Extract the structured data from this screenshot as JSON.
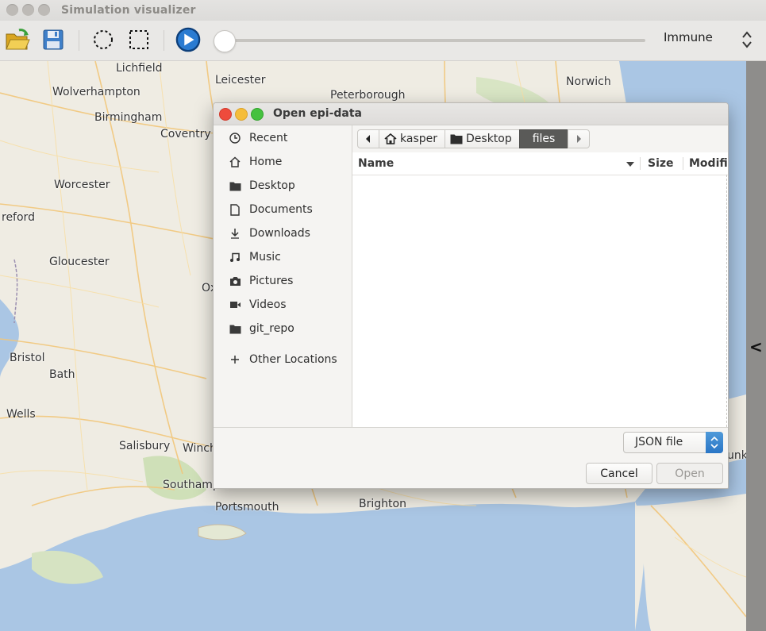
{
  "window": {
    "title": "Simulation visualizer"
  },
  "toolbar": {
    "open_icon": "folder-open-icon",
    "save_icon": "save-icon",
    "circle_select_icon": "circle-select-icon",
    "rect_select_icon": "rect-select-icon",
    "play_icon": "play-icon",
    "timeline_position": 0,
    "mode_select": {
      "value": "Immune"
    }
  },
  "map": {
    "cities": [
      "Lichfield",
      "Leicester",
      "Peterborough",
      "Norwich",
      "Wolverhampton",
      "Birmingham",
      "Coventry",
      "Worcester",
      "reford",
      "Gloucester",
      "Ox",
      "Bristol",
      "Bath",
      "Wells",
      "Salisbury",
      "Winch",
      "Southampton",
      "Portsmouth",
      "Brighton",
      "unk"
    ],
    "collapse_label": "<"
  },
  "dialog": {
    "title": "Open epi-data",
    "places": [
      {
        "label": "Recent",
        "icon": "clock-icon"
      },
      {
        "label": "Home",
        "icon": "home-icon"
      },
      {
        "label": "Desktop",
        "icon": "folder-icon"
      },
      {
        "label": "Documents",
        "icon": "document-icon"
      },
      {
        "label": "Downloads",
        "icon": "download-icon"
      },
      {
        "label": "Music",
        "icon": "music-icon"
      },
      {
        "label": "Pictures",
        "icon": "camera-icon"
      },
      {
        "label": "Videos",
        "icon": "video-icon"
      },
      {
        "label": "git_repo",
        "icon": "folder-icon"
      },
      {
        "label": "Other Locations",
        "icon": "plus-icon"
      }
    ],
    "path": [
      "kasper",
      "Desktop",
      "files"
    ],
    "columns": {
      "name": "Name",
      "size": "Size",
      "modified": "Modified"
    },
    "filter": "JSON file",
    "cancel_label": "Cancel",
    "open_label": "Open"
  },
  "colors": {
    "accent": "#2a76c6",
    "close": "#ee4b3c",
    "minimize": "#f5bd3a",
    "maximize": "#45c13f"
  }
}
